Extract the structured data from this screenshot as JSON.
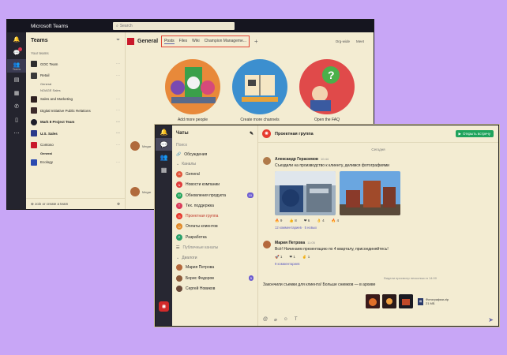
{
  "colors": {
    "accent": "#e04636",
    "brand": "#6264a7",
    "meet": "#1fa35c"
  },
  "teams": {
    "app_title": "Microsoft Teams",
    "search_placeholder": "Search",
    "panel_title": "Teams",
    "section_label": "Your teams",
    "teams_list": [
      {
        "name": "GOC Team",
        "channels": []
      },
      {
        "name": "Retail",
        "channels": [
          "General",
          "NOAGE Sales"
        ]
      },
      {
        "name": "Sales and Marketing",
        "channels": []
      },
      {
        "name": "Digital Initiative Public Relations",
        "channels": []
      },
      {
        "name": "Mark 8 Project Team",
        "bold": true,
        "channels": []
      },
      {
        "name": "U.S. Sales",
        "bold": true,
        "channels": []
      },
      {
        "name": "Contoso",
        "channels": [
          "General"
        ]
      },
      {
        "name": "Ecology",
        "channels": []
      }
    ],
    "join_label": "Join or create a team",
    "channel_title": "General",
    "tabs": [
      "Posts",
      "Files",
      "Wiki",
      "Champion Manageme..."
    ],
    "header_actions": [
      "Org-wide",
      "Meet"
    ],
    "features": [
      "Add more people",
      "Create more channels",
      "Open the FAQ"
    ],
    "peek_msgs": [
      "Megar",
      "Megar"
    ]
  },
  "messenger": {
    "sidebar_title": "Чаты",
    "search_placeholder": "Поиск",
    "discussions": "Обсуждения",
    "channels_label": "Каналы",
    "channels": [
      {
        "name": "General",
        "color": "#e0553b",
        "icon": "G"
      },
      {
        "name": "Новости компании",
        "color": "#e03b3b",
        "icon": "N"
      },
      {
        "name": "Обновления продукта",
        "color": "#22a35a",
        "icon": "22",
        "count": "10"
      },
      {
        "name": "Тех. поддержка",
        "color": "#d93c5a",
        "icon": "T"
      },
      {
        "name": "Проектная группа",
        "color": "#e63b2e",
        "icon": "П",
        "selected": true
      },
      {
        "name": "Оплаты клиентов",
        "color": "#e08a2a",
        "icon": "O"
      },
      {
        "name": "Разработка",
        "color": "#2aa06a",
        "icon": "P"
      }
    ],
    "public_channels": "Публичные каналы",
    "dialogs_label": "Диалоги",
    "dialogs": [
      {
        "name": "Мария Петрова",
        "color": "#b4683c"
      },
      {
        "name": "Борис Федоров",
        "color": "#8c5a3a",
        "count": "5"
      },
      {
        "name": "Сергей Новиков",
        "color": "#6a4a3a"
      }
    ],
    "chat_title": "Проектная группа",
    "meet_label": "Открыть встречу",
    "day_label": "Сегодня",
    "messages": [
      {
        "author": "Александр Герасимов",
        "time": "10:44",
        "text": "Съездили на производство к клиенту, делимся фотографиями",
        "reactions": [
          "🔥 9",
          "👍 8",
          "❤ 6",
          "👌 4",
          "🔥 4"
        ],
        "footer": [
          "12 комментариев",
          "5 новых"
        ]
      },
      {
        "author": "Мария Петрова",
        "time": "11:05",
        "text": "Всё! Начинаем презентацию по 4 кварталу, присоединяйтесь!",
        "reactions": [
          "🚀 1",
          "❤ 1",
          "✌ 1"
        ],
        "footer": [
          "9 комментариев"
        ]
      }
    ],
    "seen_label": "Видели просмотр несколько в 14:00",
    "last_text": "Закончили съемки для клиента! Больше снимков — в архиве",
    "file_name": "Фотографии.zip",
    "file_size": "21 МБ"
  }
}
